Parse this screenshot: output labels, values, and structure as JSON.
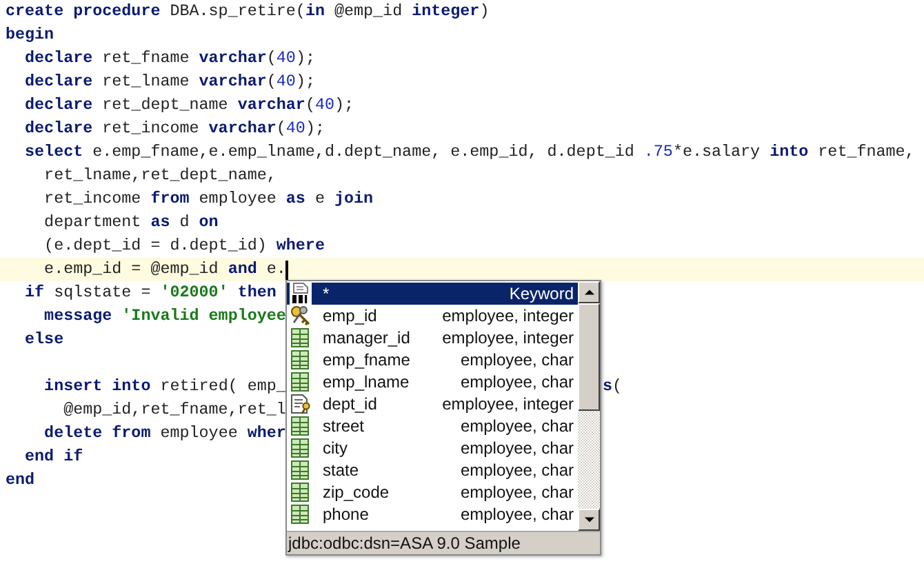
{
  "editor": {
    "lines": [
      {
        "current": false,
        "tokens": [
          {
            "kind": "keyword",
            "text": "create procedure"
          },
          {
            "kind": "plain",
            "text": " DBA.sp_retire("
          },
          {
            "kind": "keyword",
            "text": "in"
          },
          {
            "kind": "plain",
            "text": " @emp_id "
          },
          {
            "kind": "keyword",
            "text": "integer"
          },
          {
            "kind": "plain",
            "text": ")"
          }
        ]
      },
      {
        "current": false,
        "tokens": [
          {
            "kind": "keyword",
            "text": "begin"
          }
        ]
      },
      {
        "current": false,
        "tokens": [
          {
            "kind": "keyword",
            "text": "  declare"
          },
          {
            "kind": "plain",
            "text": " ret_fname "
          },
          {
            "kind": "keyword",
            "text": "varchar"
          },
          {
            "kind": "plain",
            "text": "("
          },
          {
            "kind": "number",
            "text": "40"
          },
          {
            "kind": "plain",
            "text": ");"
          }
        ]
      },
      {
        "current": false,
        "tokens": [
          {
            "kind": "keyword",
            "text": "  declare"
          },
          {
            "kind": "plain",
            "text": " ret_lname "
          },
          {
            "kind": "keyword",
            "text": "varchar"
          },
          {
            "kind": "plain",
            "text": "("
          },
          {
            "kind": "number",
            "text": "40"
          },
          {
            "kind": "plain",
            "text": ");"
          }
        ]
      },
      {
        "current": false,
        "tokens": [
          {
            "kind": "keyword",
            "text": "  declare"
          },
          {
            "kind": "plain",
            "text": " ret_dept_name "
          },
          {
            "kind": "keyword",
            "text": "varchar"
          },
          {
            "kind": "plain",
            "text": "("
          },
          {
            "kind": "number",
            "text": "40"
          },
          {
            "kind": "plain",
            "text": ");"
          }
        ]
      },
      {
        "current": false,
        "tokens": [
          {
            "kind": "keyword",
            "text": "  declare"
          },
          {
            "kind": "plain",
            "text": " ret_income "
          },
          {
            "kind": "keyword",
            "text": "varchar"
          },
          {
            "kind": "plain",
            "text": "("
          },
          {
            "kind": "number",
            "text": "40"
          },
          {
            "kind": "plain",
            "text": ");"
          }
        ]
      },
      {
        "current": false,
        "tokens": [
          {
            "kind": "keyword",
            "text": "  select"
          },
          {
            "kind": "plain",
            "text": " e.emp_fname,e.emp_lname,d.dept_name, e.emp_id, d.dept_id "
          },
          {
            "kind": "number",
            "text": ".75"
          },
          {
            "kind": "plain",
            "text": "*e.salary "
          },
          {
            "kind": "keyword",
            "text": "into"
          },
          {
            "kind": "plain",
            "text": " ret_fname,"
          }
        ]
      },
      {
        "current": false,
        "tokens": [
          {
            "kind": "plain",
            "text": "    ret_lname,ret_dept_name,"
          }
        ]
      },
      {
        "current": false,
        "tokens": [
          {
            "kind": "plain",
            "text": "    ret_income "
          },
          {
            "kind": "keyword",
            "text": "from"
          },
          {
            "kind": "plain",
            "text": " employee "
          },
          {
            "kind": "keyword",
            "text": "as"
          },
          {
            "kind": "plain",
            "text": " e "
          },
          {
            "kind": "keyword",
            "text": "join"
          }
        ]
      },
      {
        "current": false,
        "tokens": [
          {
            "kind": "plain",
            "text": "    department "
          },
          {
            "kind": "keyword",
            "text": "as"
          },
          {
            "kind": "plain",
            "text": " d "
          },
          {
            "kind": "keyword",
            "text": "on"
          }
        ]
      },
      {
        "current": false,
        "tokens": [
          {
            "kind": "plain",
            "text": "    (e.dept_id = d.dept_id) "
          },
          {
            "kind": "keyword",
            "text": "where"
          }
        ]
      },
      {
        "current": true,
        "tokens": [
          {
            "kind": "plain",
            "text": "    e.emp_id = @emp_id "
          },
          {
            "kind": "keyword",
            "text": "and"
          },
          {
            "kind": "plain",
            "text": " e."
          }
        ]
      },
      {
        "current": false,
        "tokens": [
          {
            "kind": "keyword",
            "text": "  if"
          },
          {
            "kind": "plain",
            "text": " sqlstate = "
          },
          {
            "kind": "string",
            "text": "'02000'"
          },
          {
            "kind": "keyword",
            "text": " then"
          }
        ]
      },
      {
        "current": false,
        "tokens": [
          {
            "kind": "keyword",
            "text": "    message"
          },
          {
            "kind": "string",
            "text": " 'Invalid employee"
          }
        ]
      },
      {
        "current": false,
        "tokens": [
          {
            "kind": "keyword",
            "text": "  else"
          }
        ]
      },
      {
        "current": false,
        "gap_before": true,
        "tokens": [
          {
            "kind": "keyword",
            "text": "    insert into"
          },
          {
            "kind": "plain",
            "text": " retired( emp_"
          }
        ],
        "tail": [
          {
            "kind": "keyword",
            "text": "s"
          },
          {
            "kind": "plain",
            "text": "("
          }
        ]
      },
      {
        "current": false,
        "tokens": [
          {
            "kind": "plain",
            "text": "      @emp_id,ret_fname,ret_l"
          }
        ]
      },
      {
        "current": false,
        "tokens": [
          {
            "kind": "keyword",
            "text": "    delete from"
          },
          {
            "kind": "plain",
            "text": " employee "
          },
          {
            "kind": "keyword",
            "text": "wher"
          }
        ]
      },
      {
        "current": false,
        "tokens": [
          {
            "kind": "keyword",
            "text": "  end if"
          }
        ]
      },
      {
        "current": false,
        "tokens": [
          {
            "kind": "keyword",
            "text": "end"
          }
        ]
      }
    ]
  },
  "completion": {
    "items": [
      {
        "kind": "keyword",
        "name": "*",
        "type": "Keyword",
        "selected": true
      },
      {
        "kind": "primary-key",
        "name": "emp_id",
        "type": "employee, integer",
        "selected": false
      },
      {
        "kind": "column",
        "name": "manager_id",
        "type": "employee, integer",
        "selected": false
      },
      {
        "kind": "column",
        "name": "emp_fname",
        "type": "employee, char",
        "selected": false
      },
      {
        "kind": "column",
        "name": "emp_lname",
        "type": "employee, char",
        "selected": false
      },
      {
        "kind": "foreign-key",
        "name": "dept_id",
        "type": "employee, integer",
        "selected": false
      },
      {
        "kind": "column",
        "name": "street",
        "type": "employee, char",
        "selected": false
      },
      {
        "kind": "column",
        "name": "city",
        "type": "employee, char",
        "selected": false
      },
      {
        "kind": "column",
        "name": "state",
        "type": "employee, char",
        "selected": false
      },
      {
        "kind": "column",
        "name": "zip_code",
        "type": "employee, char",
        "selected": false
      },
      {
        "kind": "column",
        "name": "phone",
        "type": "employee, char",
        "selected": false
      }
    ],
    "status": "jdbc:odbc:dsn=ASA 9.0 Sample"
  }
}
